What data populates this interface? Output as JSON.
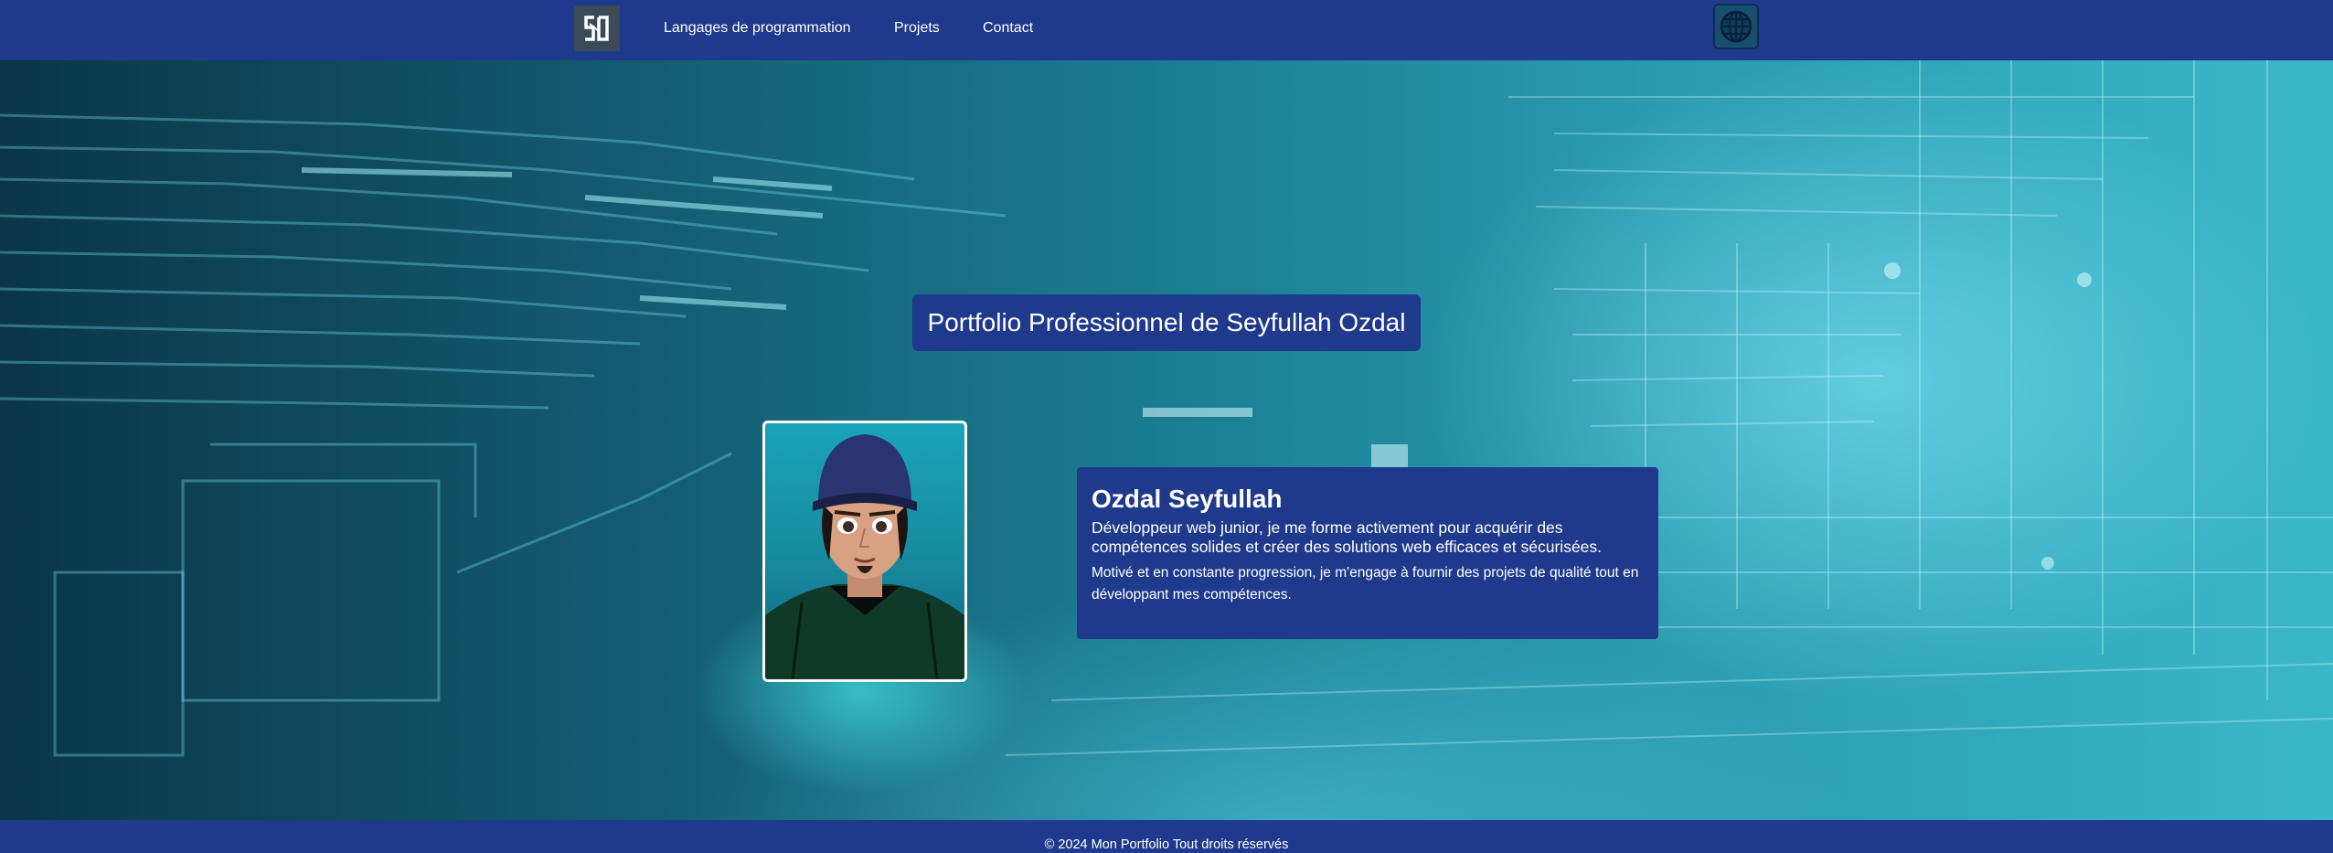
{
  "nav": {
    "logo_text": "SO",
    "links": [
      {
        "label": "Langages de programmation"
      },
      {
        "label": "Projets"
      },
      {
        "label": "Contact"
      }
    ],
    "language_icon": "globe-icon"
  },
  "hero": {
    "title": "Portfolio Professionnel de Seyfullah Ozdal",
    "profile": {
      "name": "Ozdal Seyfullah",
      "description": "Développeur web junior, je me forme activement pour acquérir des compétences solides et créer des solutions web efficaces et sécurisées.",
      "motivation": "Motivé et en constante progression, je m'engage à fournir des projets de qualité tout en développant mes compétences."
    }
  },
  "footer": {
    "text": "© 2024 Mon Portfolio Tout droits réservés"
  },
  "colors": {
    "navbar_bg": "#1f3a8c",
    "card_bg": "#1f3a8c",
    "text": "#ffffff",
    "accent_cyan": "#2b9cb1"
  }
}
